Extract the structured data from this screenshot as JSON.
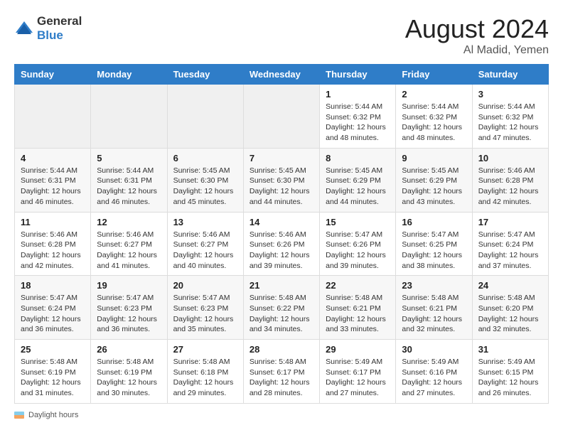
{
  "header": {
    "logo_line1": "General",
    "logo_line2": "Blue",
    "month_title": "August 2024",
    "location": "Al Madid, Yemen"
  },
  "footer": {
    "label": "Daylight hours"
  },
  "days_of_week": [
    "Sunday",
    "Monday",
    "Tuesday",
    "Wednesday",
    "Thursday",
    "Friday",
    "Saturday"
  ],
  "weeks": [
    [
      {
        "day": "",
        "info": ""
      },
      {
        "day": "",
        "info": ""
      },
      {
        "day": "",
        "info": ""
      },
      {
        "day": "",
        "info": ""
      },
      {
        "day": "1",
        "info": "Sunrise: 5:44 AM\nSunset: 6:32 PM\nDaylight: 12 hours and 48 minutes."
      },
      {
        "day": "2",
        "info": "Sunrise: 5:44 AM\nSunset: 6:32 PM\nDaylight: 12 hours and 48 minutes."
      },
      {
        "day": "3",
        "info": "Sunrise: 5:44 AM\nSunset: 6:32 PM\nDaylight: 12 hours and 47 minutes."
      }
    ],
    [
      {
        "day": "4",
        "info": "Sunrise: 5:44 AM\nSunset: 6:31 PM\nDaylight: 12 hours and 46 minutes."
      },
      {
        "day": "5",
        "info": "Sunrise: 5:44 AM\nSunset: 6:31 PM\nDaylight: 12 hours and 46 minutes."
      },
      {
        "day": "6",
        "info": "Sunrise: 5:45 AM\nSunset: 6:30 PM\nDaylight: 12 hours and 45 minutes."
      },
      {
        "day": "7",
        "info": "Sunrise: 5:45 AM\nSunset: 6:30 PM\nDaylight: 12 hours and 44 minutes."
      },
      {
        "day": "8",
        "info": "Sunrise: 5:45 AM\nSunset: 6:29 PM\nDaylight: 12 hours and 44 minutes."
      },
      {
        "day": "9",
        "info": "Sunrise: 5:45 AM\nSunset: 6:29 PM\nDaylight: 12 hours and 43 minutes."
      },
      {
        "day": "10",
        "info": "Sunrise: 5:46 AM\nSunset: 6:28 PM\nDaylight: 12 hours and 42 minutes."
      }
    ],
    [
      {
        "day": "11",
        "info": "Sunrise: 5:46 AM\nSunset: 6:28 PM\nDaylight: 12 hours and 42 minutes."
      },
      {
        "day": "12",
        "info": "Sunrise: 5:46 AM\nSunset: 6:27 PM\nDaylight: 12 hours and 41 minutes."
      },
      {
        "day": "13",
        "info": "Sunrise: 5:46 AM\nSunset: 6:27 PM\nDaylight: 12 hours and 40 minutes."
      },
      {
        "day": "14",
        "info": "Sunrise: 5:46 AM\nSunset: 6:26 PM\nDaylight: 12 hours and 39 minutes."
      },
      {
        "day": "15",
        "info": "Sunrise: 5:47 AM\nSunset: 6:26 PM\nDaylight: 12 hours and 39 minutes."
      },
      {
        "day": "16",
        "info": "Sunrise: 5:47 AM\nSunset: 6:25 PM\nDaylight: 12 hours and 38 minutes."
      },
      {
        "day": "17",
        "info": "Sunrise: 5:47 AM\nSunset: 6:24 PM\nDaylight: 12 hours and 37 minutes."
      }
    ],
    [
      {
        "day": "18",
        "info": "Sunrise: 5:47 AM\nSunset: 6:24 PM\nDaylight: 12 hours and 36 minutes."
      },
      {
        "day": "19",
        "info": "Sunrise: 5:47 AM\nSunset: 6:23 PM\nDaylight: 12 hours and 36 minutes."
      },
      {
        "day": "20",
        "info": "Sunrise: 5:47 AM\nSunset: 6:23 PM\nDaylight: 12 hours and 35 minutes."
      },
      {
        "day": "21",
        "info": "Sunrise: 5:48 AM\nSunset: 6:22 PM\nDaylight: 12 hours and 34 minutes."
      },
      {
        "day": "22",
        "info": "Sunrise: 5:48 AM\nSunset: 6:21 PM\nDaylight: 12 hours and 33 minutes."
      },
      {
        "day": "23",
        "info": "Sunrise: 5:48 AM\nSunset: 6:21 PM\nDaylight: 12 hours and 32 minutes."
      },
      {
        "day": "24",
        "info": "Sunrise: 5:48 AM\nSunset: 6:20 PM\nDaylight: 12 hours and 32 minutes."
      }
    ],
    [
      {
        "day": "25",
        "info": "Sunrise: 5:48 AM\nSunset: 6:19 PM\nDaylight: 12 hours and 31 minutes."
      },
      {
        "day": "26",
        "info": "Sunrise: 5:48 AM\nSunset: 6:19 PM\nDaylight: 12 hours and 30 minutes."
      },
      {
        "day": "27",
        "info": "Sunrise: 5:48 AM\nSunset: 6:18 PM\nDaylight: 12 hours and 29 minutes."
      },
      {
        "day": "28",
        "info": "Sunrise: 5:48 AM\nSunset: 6:17 PM\nDaylight: 12 hours and 28 minutes."
      },
      {
        "day": "29",
        "info": "Sunrise: 5:49 AM\nSunset: 6:17 PM\nDaylight: 12 hours and 27 minutes."
      },
      {
        "day": "30",
        "info": "Sunrise: 5:49 AM\nSunset: 6:16 PM\nDaylight: 12 hours and 27 minutes."
      },
      {
        "day": "31",
        "info": "Sunrise: 5:49 AM\nSunset: 6:15 PM\nDaylight: 12 hours and 26 minutes."
      }
    ]
  ]
}
